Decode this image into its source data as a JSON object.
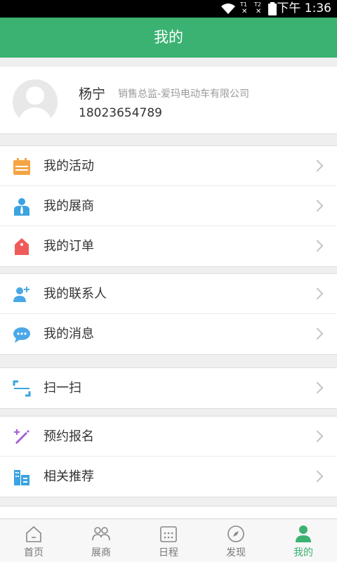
{
  "status_bar": {
    "time": "下午 1:36",
    "sim1": "T1",
    "sim2": "T2"
  },
  "header": {
    "title": "我的"
  },
  "profile": {
    "name": "杨宁",
    "title": "销售总监-爱玛电动车有限公司",
    "phone": "18023654789"
  },
  "menu": {
    "activity": "我的活动",
    "exhibitors": "我的展商",
    "orders": "我的订单",
    "contacts": "我的联系人",
    "messages": "我的消息",
    "scan": "扫一扫",
    "booking": "预约报名",
    "recommend": "相关推荐"
  },
  "tabs": {
    "home": "首页",
    "exhibitors": "展商",
    "schedule": "日程",
    "discover": "发现",
    "mine": "我的"
  },
  "colors": {
    "brand": "#3bb272",
    "activity": "#f5a445",
    "exhibitor": "#3ba3e0",
    "order": "#ef5b5b",
    "contact": "#4aa8e8",
    "scan": "#3ba3e0",
    "booking": "#a45ed6"
  }
}
